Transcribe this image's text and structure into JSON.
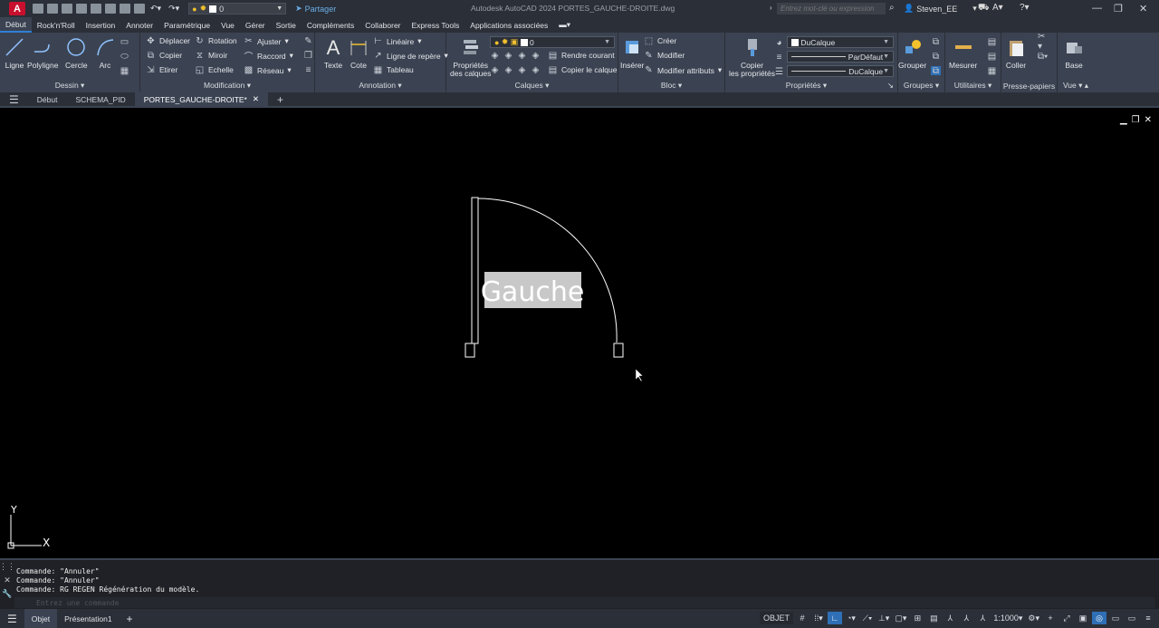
{
  "app": {
    "logo_letter": "A",
    "title": "Autodesk AutoCAD 2024   PORTES_GAUCHE-DROITE.dwg",
    "share_label": "Partager",
    "layer_current": "0",
    "search_placeholder": "Entrez mot-clé ou expression",
    "user_name": "Steven_EE"
  },
  "ribbon_tabs": [
    "Début",
    "Rock'n'Roll",
    "Insertion",
    "Annoter",
    "Paramétrique",
    "Vue",
    "Gérer",
    "Sortie",
    "Compléments",
    "Collaborer",
    "Express Tools",
    "Applications associées"
  ],
  "ribbon": {
    "dessin": {
      "title": "Dessin",
      "ligne": "Ligne",
      "polyligne": "Polyligne",
      "cercle": "Cercle",
      "arc": "Arc"
    },
    "modification": {
      "title": "Modification",
      "deplacer": "Déplacer",
      "rotation": "Rotation",
      "ajuster": "Ajuster",
      "copier": "Copier",
      "miroir": "Miroir",
      "raccord": "Raccord",
      "etirer": "Etirer",
      "echelle": "Echelle",
      "reseau": "Réseau"
    },
    "annotation": {
      "title": "Annotation",
      "texte": "Texte",
      "cote": "Cote",
      "lineaire": "Linéaire",
      "ligne_repere": "Ligne de repère",
      "tableau": "Tableau"
    },
    "calques": {
      "title": "Calques",
      "proprietes_l1": "Propriétés",
      "proprietes_l2": "des calques",
      "layer": "0",
      "rendre_courant": "Rendre courant",
      "copier_calque": "Copier le calque"
    },
    "bloc": {
      "title": "Bloc",
      "inserer": "Insérer",
      "creer": "Créer",
      "modifier": "Modifier",
      "modifier_attributs": "Modifier attributs"
    },
    "proprietes": {
      "title": "Propriétés",
      "copier_l1": "Copier",
      "copier_l2": "les propriétés",
      "color": "DuCalque",
      "lineweight": "ParDéfaut",
      "linetype": "DuCalque"
    },
    "groupes": {
      "title": "Groupes",
      "grouper": "Grouper"
    },
    "utilitaires": {
      "title": "Utilitaires",
      "mesurer": "Mesurer"
    },
    "presse_papiers": {
      "title": "Presse-papiers",
      "coller": "Coller"
    },
    "vue": {
      "title": "Vue",
      "base": "Base"
    }
  },
  "file_tabs": [
    "Début",
    "SCHEMA_PID",
    "PORTES_GAUCHE-DROITE*"
  ],
  "drawing": {
    "label": "Gauche",
    "ucs_x": "X",
    "ucs_y": "Y"
  },
  "command": {
    "history": [
      "Commande: \"Annuler\"",
      "Commande: \"Annuler\"",
      "Commande: RG REGEN Régénération du modèle."
    ],
    "placeholder": "Entrez une commande"
  },
  "status": {
    "tabs": [
      "Objet",
      "Présentation1"
    ],
    "mode": "OBJET",
    "scale": "1:1000"
  },
  "colors": {
    "accent": "#2f7fd6",
    "logo": "#c8102e",
    "ribbon_bg": "#3b4352",
    "chrome_bg": "#2b2f38"
  }
}
